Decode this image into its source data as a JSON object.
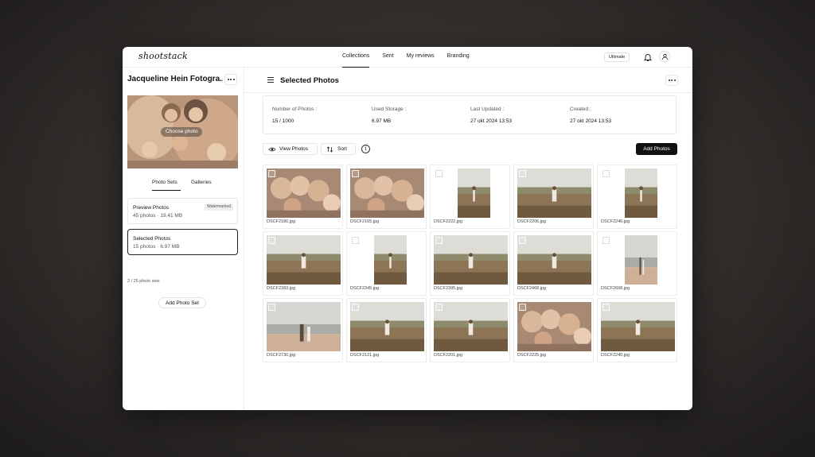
{
  "app": {
    "logo": "shootstack",
    "plan": "Ultimate"
  },
  "nav": [
    {
      "label": "Collections",
      "active": true
    },
    {
      "label": "Sent",
      "active": false
    },
    {
      "label": "My reviews",
      "active": false
    },
    {
      "label": "Branding",
      "active": false
    }
  ],
  "icons": {
    "bell": "bell-icon",
    "user": "user-icon",
    "more": "more-horizontal-icon",
    "menu": "menu-icon",
    "view": "eye-icon",
    "sort": "sort-icon",
    "info": "info-icon"
  },
  "sidebar": {
    "collection_title": "Jacqueline Hein Fotogra...",
    "cover_button": "Choose photo",
    "tabs": [
      {
        "label": "Photo Sets",
        "active": true
      },
      {
        "label": "Galleries",
        "active": false
      }
    ],
    "sets": [
      {
        "name": "Preview Photos",
        "meta": "45 photos · 19.41 MB",
        "badge": "Watermarked",
        "selected": false
      },
      {
        "name": "Selected Photos",
        "meta": "15 photos · 6.97 MB",
        "badge": "",
        "selected": true
      }
    ],
    "sets_count": "2 / 25 photo sets",
    "add_set_label": "Add Photo Set"
  },
  "main": {
    "title": "Selected Photos",
    "stats": [
      {
        "label": "Number of Photos :",
        "value": "15 / 1000"
      },
      {
        "label": "Used Storage :",
        "value": "6.97 MB"
      },
      {
        "label": "Last Updated :",
        "value": "27 okt 2024 13:53"
      },
      {
        "label": "Created :",
        "value": "27 okt 2024 13:53"
      }
    ],
    "toolbar": {
      "view_label": "View Photos",
      "sort_label": "Sort",
      "info": "i",
      "add_label": "Add Photos"
    },
    "photos": [
      {
        "file": "DSCF2180.jpg",
        "orientation": "landscape",
        "scene": "faces"
      },
      {
        "file": "DSCF2165.jpg",
        "orientation": "landscape",
        "scene": "faces"
      },
      {
        "file": "DSCF2222.jpg",
        "orientation": "portrait",
        "scene": "field"
      },
      {
        "file": "DSCF2206.jpg",
        "orientation": "landscape",
        "scene": "field"
      },
      {
        "file": "DSCF2246.jpg",
        "orientation": "portrait",
        "scene": "field"
      },
      {
        "file": "DSCF2283.jpg",
        "orientation": "landscape",
        "scene": "field"
      },
      {
        "file": "DSCF2345.jpg",
        "orientation": "portrait",
        "scene": "field"
      },
      {
        "file": "DSCF2395.jpg",
        "orientation": "landscape",
        "scene": "field"
      },
      {
        "file": "DSCF2468.jpg",
        "orientation": "landscape",
        "scene": "field"
      },
      {
        "file": "DSCF2668.jpg",
        "orientation": "portrait",
        "scene": "beach"
      },
      {
        "file": "DSCF2730.jpg",
        "orientation": "landscape",
        "scene": "beach"
      },
      {
        "file": "DSCF2121.jpg",
        "orientation": "landscape",
        "scene": "field"
      },
      {
        "file": "DSCF2201.jpg",
        "orientation": "landscape",
        "scene": "field"
      },
      {
        "file": "DSCF2225.jpg",
        "orientation": "landscape",
        "scene": "faces"
      },
      {
        "file": "DSCF2240.jpg",
        "orientation": "landscape",
        "scene": "field"
      }
    ]
  }
}
